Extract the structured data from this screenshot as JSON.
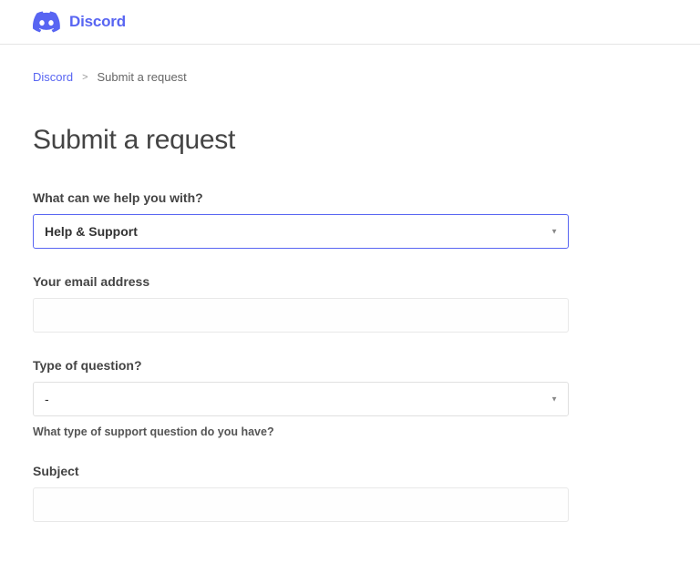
{
  "brand": {
    "name": "Discord",
    "color": "#5865f2"
  },
  "breadcrumb": {
    "home_label": "Discord",
    "separator": ">",
    "current": "Submit a request"
  },
  "page": {
    "title": "Submit a request"
  },
  "form": {
    "help_topic": {
      "label": "What can we help you with?",
      "value": "Help & Support"
    },
    "email": {
      "label": "Your email address",
      "value": ""
    },
    "question_type": {
      "label": "Type of question?",
      "value": "-",
      "help_text": "What type of support question do you have?"
    },
    "subject": {
      "label": "Subject",
      "value": ""
    }
  }
}
